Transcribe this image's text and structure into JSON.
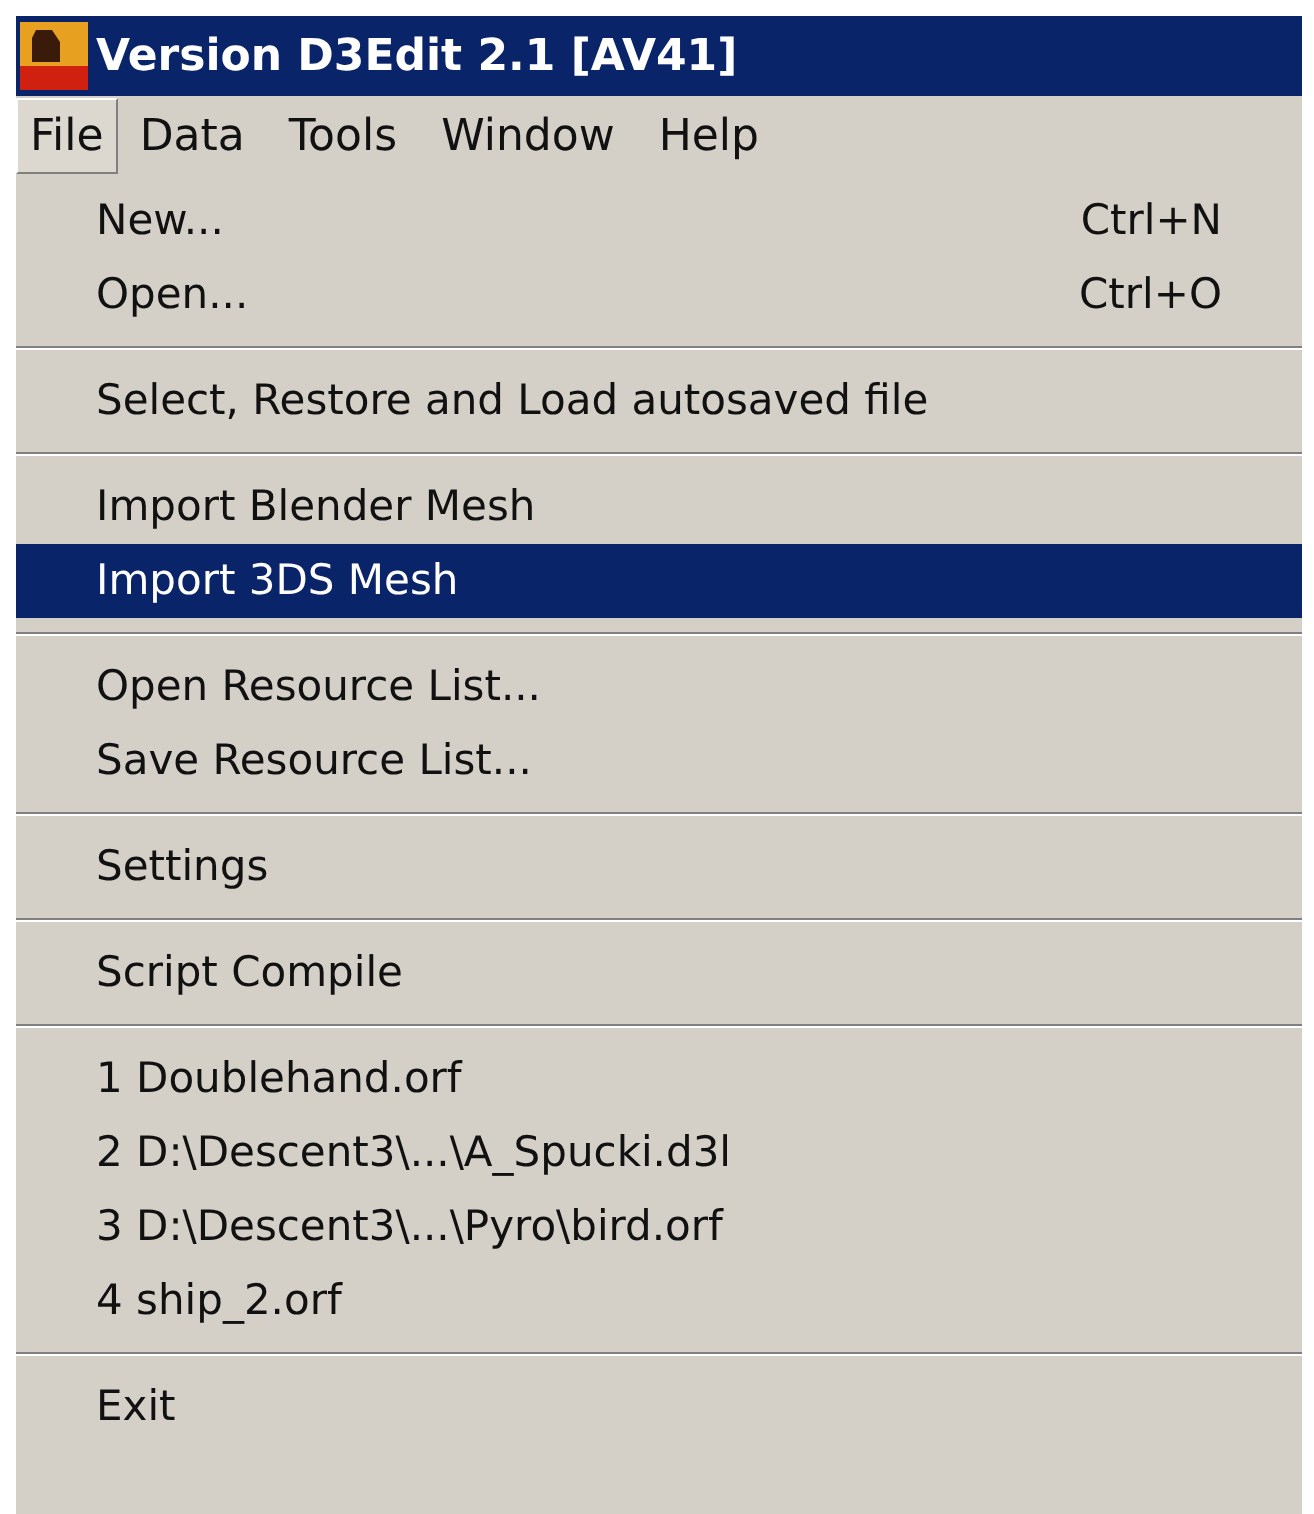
{
  "window": {
    "title": "Version D3Edit 2.1 [AV41]"
  },
  "menu_bar": [
    {
      "label": "File",
      "selected": true
    },
    {
      "label": "Data",
      "selected": false
    },
    {
      "label": "Tools",
      "selected": false
    },
    {
      "label": "Window",
      "selected": false
    },
    {
      "label": "Help",
      "selected": false
    }
  ],
  "file_menu": [
    [
      {
        "label": "New...",
        "shortcut": "Ctrl+N",
        "selected": false
      },
      {
        "label": "Open...",
        "shortcut": "Ctrl+O",
        "selected": false
      }
    ],
    [
      {
        "label": "Select, Restore and Load autosaved file",
        "selected": false
      }
    ],
    [
      {
        "label": "Import Blender Mesh",
        "selected": false
      },
      {
        "label": "Import 3DS Mesh",
        "selected": true
      }
    ],
    [
      {
        "label": "Open Resource List...",
        "selected": false
      },
      {
        "label": "Save Resource List...",
        "selected": false
      }
    ],
    [
      {
        "label": "Settings",
        "selected": false
      }
    ],
    [
      {
        "label": "Script Compile",
        "selected": false
      }
    ],
    [
      {
        "label": "1 Doublehand.orf",
        "selected": false
      },
      {
        "label": "2 D:\\Descent3\\...\\A_Spucki.d3l",
        "selected": false
      },
      {
        "label": "3 D:\\Descent3\\...\\Pyro\\bird.orf",
        "selected": false
      },
      {
        "label": "4 ship_2.orf",
        "selected": false
      }
    ],
    [
      {
        "label": "Exit",
        "selected": false
      }
    ]
  ]
}
